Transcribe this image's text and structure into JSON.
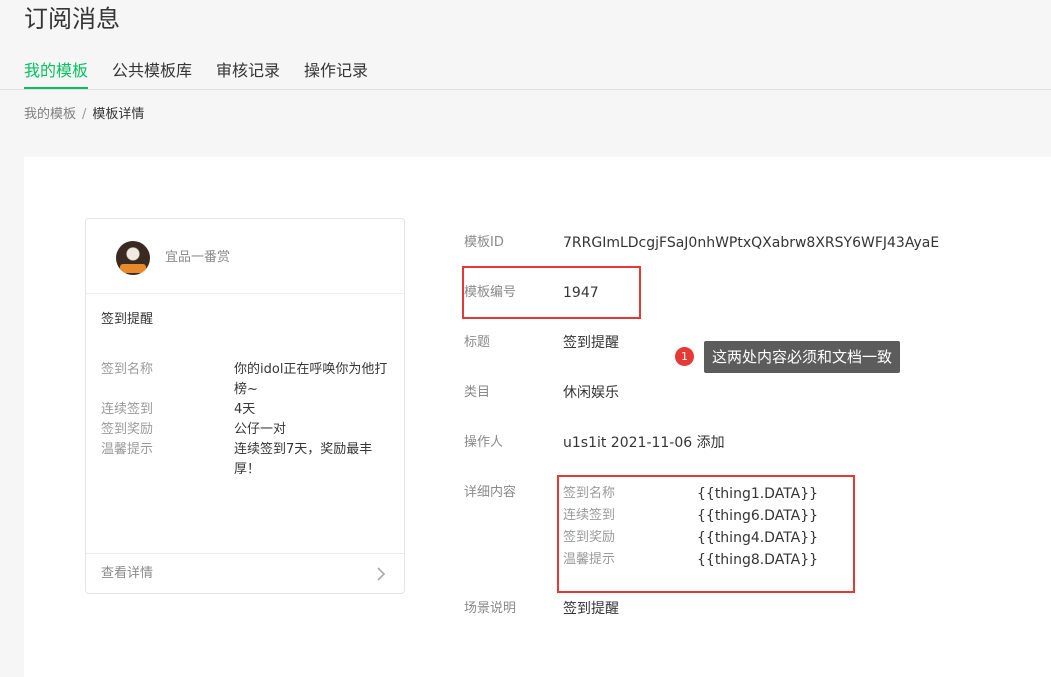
{
  "page": {
    "title": "订阅消息"
  },
  "tabs": [
    {
      "label": "我的模板",
      "active": true
    },
    {
      "label": "公共模板库",
      "active": false
    },
    {
      "label": "审核记录",
      "active": false
    },
    {
      "label": "操作记录",
      "active": false
    }
  ],
  "breadcrumb": {
    "parent": "我的模板",
    "separator": "/",
    "current": "模板详情"
  },
  "preview": {
    "account_name": "宜品一番赏",
    "title": "签到提醒",
    "fields": [
      {
        "label": "签到名称",
        "value": "你的idol正在呼唤你为他打榜~"
      },
      {
        "label": "连续签到",
        "value": "4天"
      },
      {
        "label": "签到奖励",
        "value": "公仔一对"
      },
      {
        "label": "温馨提示",
        "value": "连续签到7天，奖励最丰厚！"
      }
    ],
    "view_details": "查看详情"
  },
  "info": {
    "template_id_label": "模板ID",
    "template_id_value": "7RRGImLDcgjFSaJ0nhWPtxQXabrw8XRSY6WFJ43AyaE",
    "template_number_label": "模板编号",
    "template_number_value": "1947",
    "title_label": "标题",
    "title_value": "签到提醒",
    "category_label": "类目",
    "category_value": "休闲娱乐",
    "operator_label": "操作人",
    "operator_value": "u1s1it 2021-11-06 添加",
    "detail_label": "详细内容",
    "details": [
      {
        "label": "签到名称",
        "value": "{{thing1.DATA}}"
      },
      {
        "label": "连续签到",
        "value": "{{thing6.DATA}}"
      },
      {
        "label": "签到奖励",
        "value": "{{thing4.DATA}}"
      },
      {
        "label": "温馨提示",
        "value": "{{thing8.DATA}}"
      }
    ],
    "scene_label": "场景说明",
    "scene_value": "签到提醒"
  },
  "annotation": {
    "number": "1",
    "text": "这两处内容必须和文档一致"
  },
  "colors": {
    "accent": "#07c160",
    "annotation_red": "#e53935",
    "tooltip_bg": "#5c5c5c"
  },
  "icons": {
    "view_details": "chevron-right-icon",
    "account": "avatar"
  }
}
